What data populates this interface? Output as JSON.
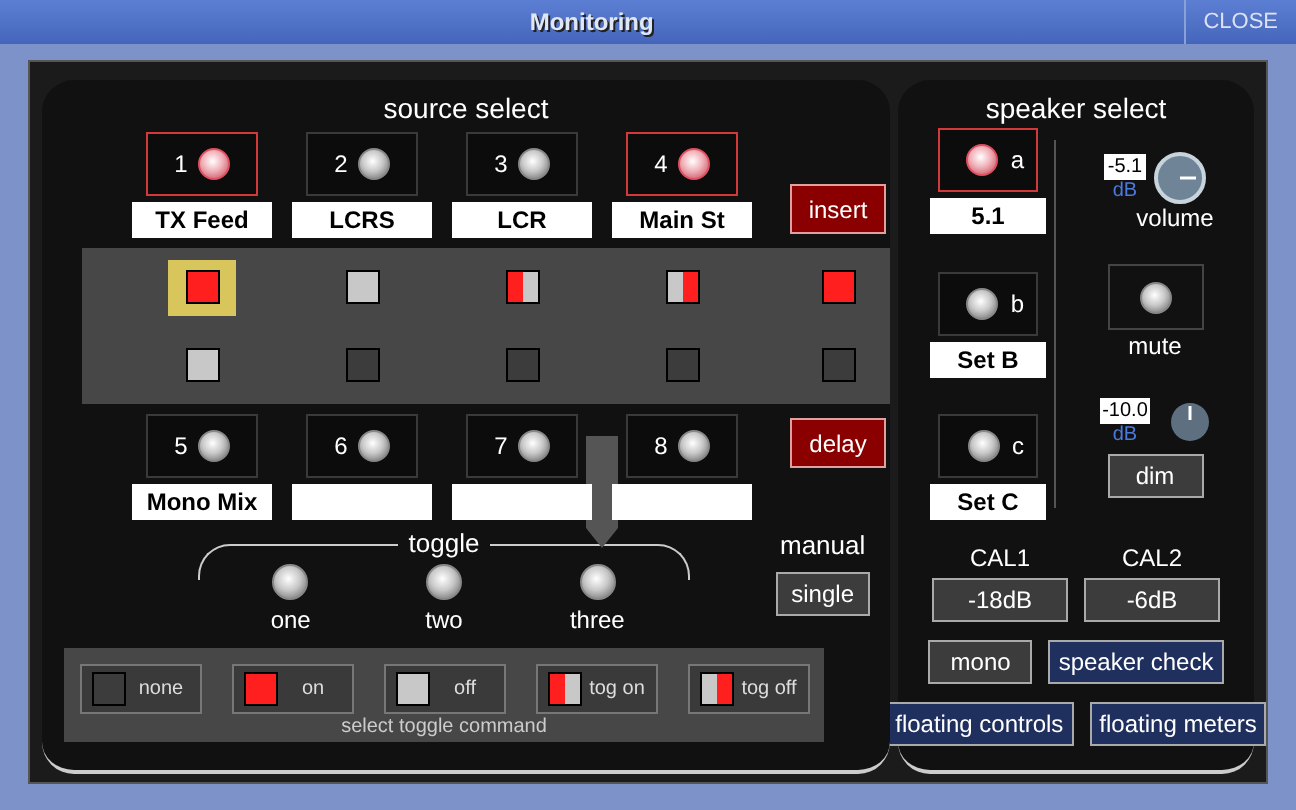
{
  "window": {
    "title": "Monitoring",
    "close": "CLOSE"
  },
  "source_select": {
    "title": "source select",
    "sources": [
      {
        "number": "1",
        "label": "TX Feed",
        "selected": true
      },
      {
        "number": "2",
        "label": "LCRS",
        "selected": false
      },
      {
        "number": "3",
        "label": "LCR",
        "selected": false
      },
      {
        "number": "4",
        "label": "Main St",
        "selected": true
      },
      {
        "number": "5",
        "label": "Mono Mix",
        "selected": false
      },
      {
        "number": "6",
        "selected": false
      },
      {
        "number": "7",
        "selected": false
      },
      {
        "number": "8",
        "selected": false
      }
    ]
  },
  "insert": "insert",
  "delay": "delay",
  "matrix": [
    [
      {
        "kind": "on",
        "selected": true
      },
      {
        "kind": "off",
        "selected": false
      },
      {
        "kind": "tog_on",
        "selected": false
      },
      {
        "kind": "tog_off",
        "selected": false
      },
      {
        "kind": "on",
        "selected": false
      }
    ],
    [
      {
        "kind": "off",
        "selected": false
      },
      {
        "kind": "none",
        "selected": false
      },
      {
        "kind": "none",
        "selected": false
      },
      {
        "kind": "none",
        "selected": false
      },
      {
        "kind": "none",
        "selected": false
      }
    ]
  ],
  "toggle": {
    "title": "toggle",
    "options": [
      {
        "label": "one",
        "on": false
      },
      {
        "label": "two",
        "on": false
      },
      {
        "label": "three",
        "on": false
      }
    ]
  },
  "manual": {
    "label": "manual",
    "button": "single"
  },
  "commands": {
    "caption": "select toggle command",
    "items": [
      {
        "kind": "none",
        "label": "none"
      },
      {
        "kind": "on",
        "label": "on"
      },
      {
        "kind": "off",
        "label": "off"
      },
      {
        "kind": "tog_on",
        "label": "tog on"
      },
      {
        "kind": "tog_off",
        "label": "tog off"
      }
    ]
  },
  "speaker_select": {
    "title": "speaker select",
    "speakers": [
      {
        "letter": "a",
        "label": "5.1",
        "selected": true
      },
      {
        "letter": "b",
        "label": "Set B",
        "selected": false
      },
      {
        "letter": "c",
        "label": "Set C",
        "selected": false
      }
    ]
  },
  "volume": {
    "value": "-5.1",
    "unit": "dB",
    "label": "volume"
  },
  "mute": {
    "label": "mute",
    "on": false
  },
  "dim": {
    "value": "-10.0",
    "unit": "dB",
    "button": "dim"
  },
  "cal": [
    {
      "label": "CAL1",
      "value": "-18dB"
    },
    {
      "label": "CAL2",
      "value": "-6dB"
    }
  ],
  "button_rows": [
    [
      {
        "label": "mono",
        "kind": "plain"
      },
      {
        "label": "speaker check",
        "kind": "blue"
      }
    ],
    [
      {
        "label": "floating controls",
        "kind": "blue"
      },
      {
        "label": "floating meters",
        "kind": "blue"
      }
    ]
  ]
}
